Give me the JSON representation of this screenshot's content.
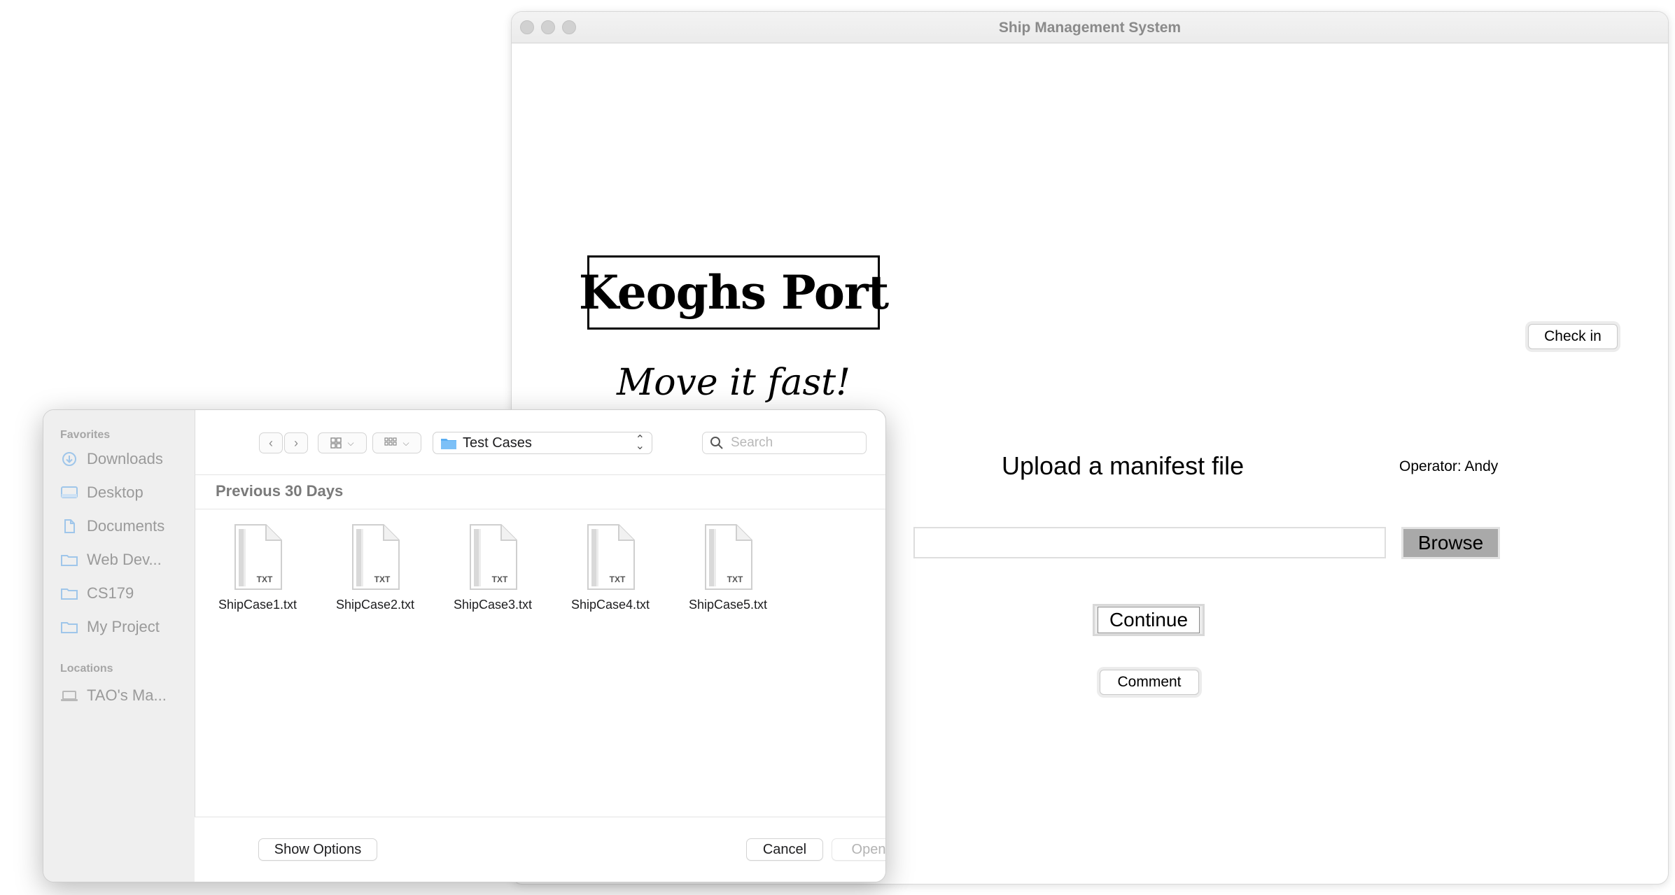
{
  "app": {
    "window_title": "Ship Management System",
    "brand": "Keoghs Port",
    "tagline": "Move it fast!",
    "check_in_label": "Check in",
    "upload_heading": "Upload a manifest file",
    "operator_label": "Operator: Andy",
    "manifest_path_value": "",
    "browse_label": "Browse",
    "continue_label": "Continue",
    "comment_label": "Comment"
  },
  "dialog": {
    "sidebar": {
      "favorites_heading": "Favorites",
      "favorites": [
        {
          "label": "Downloads",
          "icon": "downloads-icon"
        },
        {
          "label": "Desktop",
          "icon": "desktop-icon"
        },
        {
          "label": "Documents",
          "icon": "document-icon"
        },
        {
          "label": "Web Dev...",
          "icon": "folder-icon"
        },
        {
          "label": "CS179",
          "icon": "folder-icon"
        },
        {
          "label": "My Project",
          "icon": "folder-icon"
        }
      ],
      "locations_heading": "Locations",
      "locations": [
        {
          "label": "TAO's Ma...",
          "icon": "laptop-icon"
        }
      ]
    },
    "toolbar": {
      "current_folder": "Test Cases",
      "search_placeholder": "Search"
    },
    "section_heading": "Previous 30 Days",
    "files": [
      {
        "name": "ShipCase1.txt",
        "badge": "TXT"
      },
      {
        "name": "ShipCase2.txt",
        "badge": "TXT"
      },
      {
        "name": "ShipCase3.txt",
        "badge": "TXT"
      },
      {
        "name": "ShipCase4.txt",
        "badge": "TXT"
      },
      {
        "name": "ShipCase5.txt",
        "badge": "TXT"
      }
    ],
    "footer": {
      "show_options_label": "Show Options",
      "cancel_label": "Cancel",
      "open_label": "Open"
    }
  },
  "colors": {
    "folder_blue": "#5aaef2",
    "sidebar_icon": "#9fc6ea",
    "disabled_text": "#b3b3b3"
  }
}
